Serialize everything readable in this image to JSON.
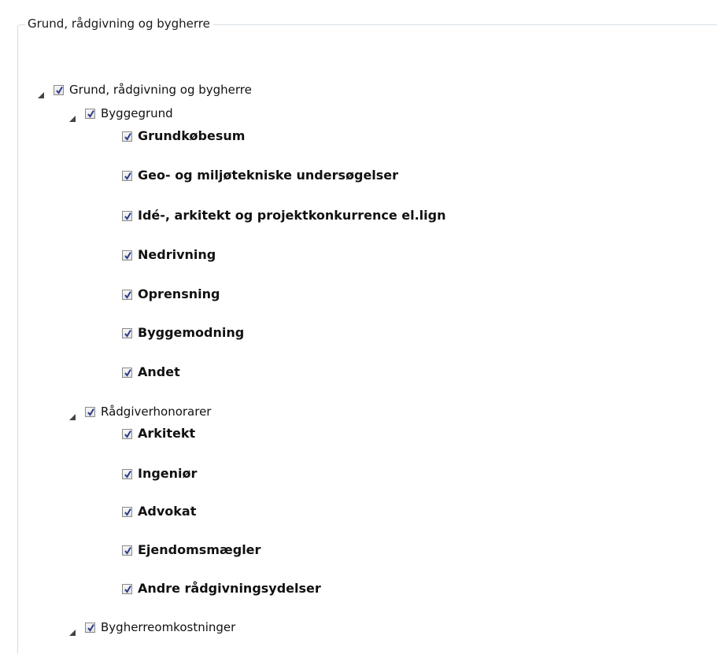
{
  "group": {
    "title": "Grund, rådgivning og bygherre"
  },
  "tree": {
    "root": {
      "label": "Grund, rådgivning og bygherre",
      "checked": true,
      "expanded": true
    },
    "byggegrund": {
      "label": "Byggegrund",
      "checked": true,
      "expanded": true,
      "items": [
        {
          "label": "Grundkøbesum",
          "checked": true
        },
        {
          "label": "Geo- og miljøtekniske undersøgelser",
          "checked": true
        },
        {
          "label": "Idé-, arkitekt og projektkonkurrence el.lign",
          "checked": true
        },
        {
          "label": "Nedrivning",
          "checked": true
        },
        {
          "label": "Oprensning",
          "checked": true
        },
        {
          "label": "Byggemodning",
          "checked": true
        },
        {
          "label": "Andet",
          "checked": true
        }
      ]
    },
    "raadgiver": {
      "label": "Rådgiverhonorarer",
      "checked": true,
      "expanded": true,
      "items": [
        {
          "label": "Arkitekt",
          "checked": true
        },
        {
          "label": "Ingeniør",
          "checked": true
        },
        {
          "label": "Advokat",
          "checked": true
        },
        {
          "label": "Ejendomsmægler",
          "checked": true
        },
        {
          "label": "Andre rådgivningsydelser",
          "checked": true
        }
      ]
    },
    "bygherre": {
      "label": "Bygherreomkostninger",
      "checked": true,
      "expanded": true
    }
  },
  "colors": {
    "check": "#2b3a8a",
    "border": "#d5dfe5"
  }
}
